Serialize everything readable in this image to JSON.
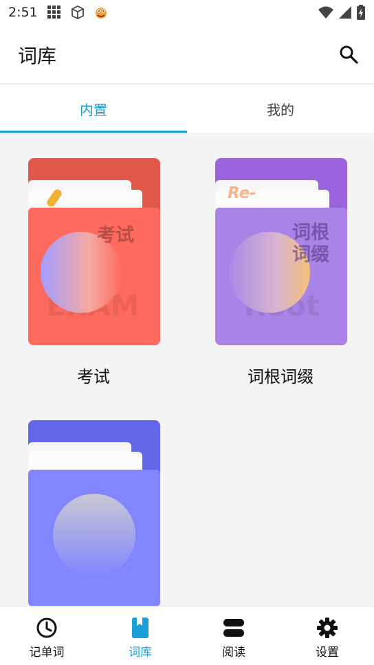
{
  "status_bar": {
    "time": "2:51",
    "icons": [
      "grid-icon",
      "cube-icon",
      "cookie-monster-icon",
      "wifi-icon",
      "signal-icon",
      "battery-charging-icon"
    ]
  },
  "app_bar": {
    "title": "词库",
    "search_icon": "search-icon"
  },
  "tabs": [
    {
      "label": "内置",
      "active": true
    },
    {
      "label": "我的",
      "active": false
    }
  ],
  "books": [
    {
      "name": "考试",
      "cover_text": "考试",
      "watermark": "EXAM",
      "accent": "#ff6a5f"
    },
    {
      "name": "词根词缀",
      "cover_text_line1": "词根",
      "cover_text_line2": "词缀",
      "badge": "Re-",
      "watermark": "Root",
      "accent": "#a884e6"
    },
    {
      "name": "",
      "accent": "#8186ff"
    }
  ],
  "bottom_nav": [
    {
      "label": "记单词",
      "icon": "clock-icon",
      "active": false
    },
    {
      "label": "词库",
      "icon": "book-icon",
      "active": true
    },
    {
      "label": "阅读",
      "icon": "reading-icon",
      "active": false
    },
    {
      "label": "设置",
      "icon": "gear-icon",
      "active": false
    }
  ],
  "colors": {
    "accent": "#1a9fd6",
    "text": "#111111"
  }
}
